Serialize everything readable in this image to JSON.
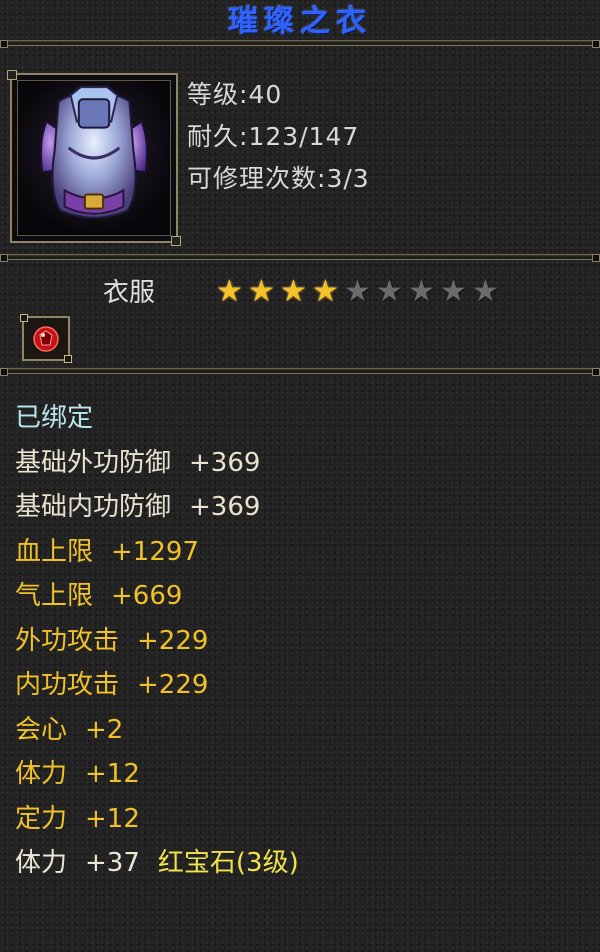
{
  "item": {
    "name": "璀璨之衣",
    "level_label": "等级:",
    "level_value": "40",
    "durability_label": "耐久:",
    "durability_value": "123/147",
    "repair_label": "可修理次数:",
    "repair_value": "3/3",
    "portrait_icon": "armor-portrait",
    "type": "衣服",
    "stars_total": 9,
    "stars_filled": 4,
    "gem_icon": "red-gem-icon"
  },
  "properties": [
    {
      "name": "已绑定",
      "value": "",
      "extra": "",
      "color": "bound"
    },
    {
      "name": "基础外功防御",
      "value": "+369",
      "extra": "",
      "color": "base"
    },
    {
      "name": "基础内功防御",
      "value": "+369",
      "extra": "",
      "color": "base"
    },
    {
      "name": "血上限",
      "value": "+1297",
      "extra": "",
      "color": "gold"
    },
    {
      "name": "气上限",
      "value": "+669",
      "extra": "",
      "color": "gold"
    },
    {
      "name": "外功攻击",
      "value": "+229",
      "extra": "",
      "color": "gold"
    },
    {
      "name": "内功攻击",
      "value": "+229",
      "extra": "",
      "color": "gold"
    },
    {
      "name": "会心",
      "value": "+2",
      "extra": "",
      "color": "gold"
    },
    {
      "name": "体力",
      "value": "+12",
      "extra": "",
      "color": "gold"
    },
    {
      "name": "定力",
      "value": "+12",
      "extra": "",
      "color": "gold"
    },
    {
      "name": "体力",
      "value": "+37",
      "extra": "红宝石(3级)",
      "color": "white"
    }
  ],
  "colors": {
    "title": "#2f62ff",
    "bound": "#b9e8ee",
    "base": "#e9e2cf",
    "gold": "#f1c228",
    "gem_text": "#f2e24a",
    "star_on": "#f2c22e",
    "star_off": "#6b6b6b"
  }
}
